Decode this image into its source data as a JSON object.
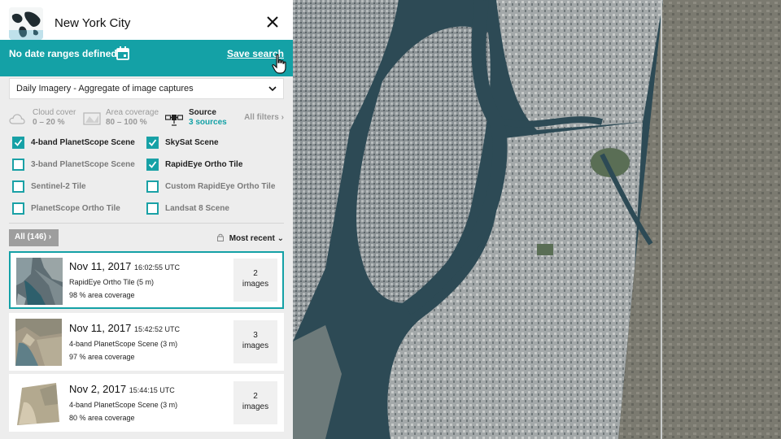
{
  "search": {
    "title": "New York City",
    "date_range_text": "No date ranges defined",
    "save_label": "Save search"
  },
  "imagery": {
    "selected": "Daily Imagery - Aggregate of image captures"
  },
  "filters": {
    "cloud_label": "Cloud cover",
    "cloud_value": "0 – 20 %",
    "area_label": "Area coverage",
    "area_value": "80 – 100 %",
    "source_label": "Source",
    "source_value": "3 sources",
    "all_filters": "All filters"
  },
  "sources": [
    {
      "label": "4-band PlanetScope Scene",
      "checked": true
    },
    {
      "label": "SkySat Scene",
      "checked": true
    },
    {
      "label": "3-band PlanetScope Scene",
      "checked": false
    },
    {
      "label": "RapidEye Ortho Tile",
      "checked": true
    },
    {
      "label": "Sentinel-2 Tile",
      "checked": false
    },
    {
      "label": "Custom RapidEye Ortho Tile",
      "checked": false
    },
    {
      "label": "PlanetScope Ortho Tile",
      "checked": false
    },
    {
      "label": "Landsat 8 Scene",
      "checked": false
    }
  ],
  "results": {
    "all_label": "All (146)",
    "sort_label": "Most recent",
    "items": [
      {
        "date": "Nov 11, 2017",
        "time": "16:02:55 UTC",
        "source": "RapidEye Ortho Tile (5 m)",
        "coverage": "98 % area coverage",
        "count": "2",
        "count_unit": "images",
        "selected": true
      },
      {
        "date": "Nov 11, 2017",
        "time": "15:42:52 UTC",
        "source": "4-band PlanetScope Scene (3 m)",
        "coverage": "97 % area coverage",
        "count": "3",
        "count_unit": "images",
        "selected": false
      },
      {
        "date": "Nov 2, 2017",
        "time": "15:44:15 UTC",
        "source": "4-band PlanetScope Scene (3 m)",
        "coverage": "80 % area coverage",
        "count": "2",
        "count_unit": "images",
        "selected": false
      }
    ]
  },
  "colors": {
    "accent": "#14a1a6",
    "panel_bg": "#ededed"
  }
}
